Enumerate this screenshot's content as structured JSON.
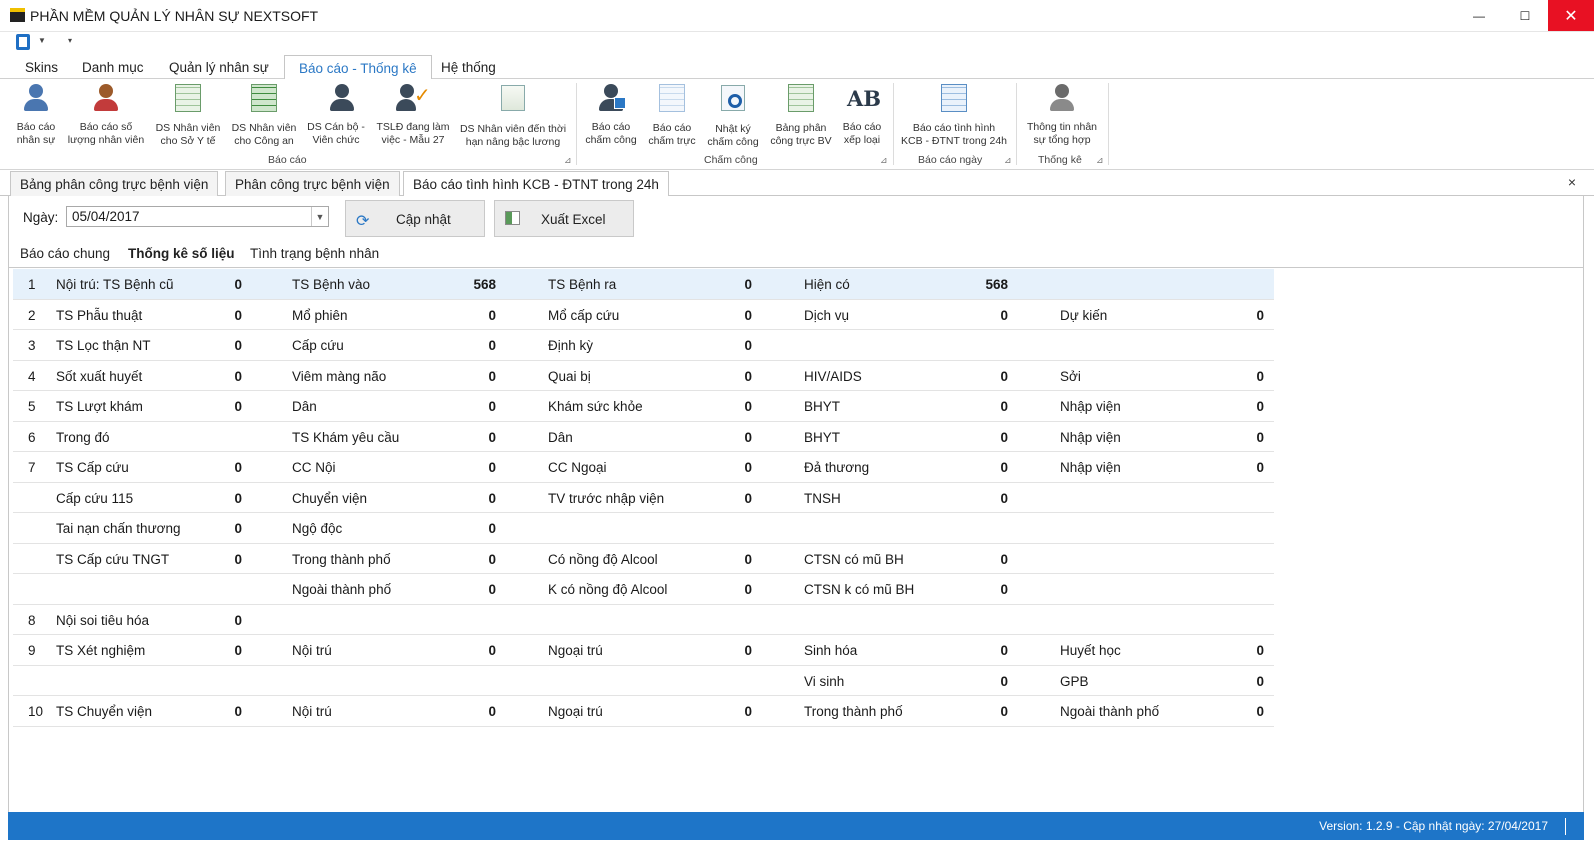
{
  "window": {
    "title": "PHẦN MỀM QUẢN LÝ NHÂN SỰ NEXTSOFT",
    "min": "—",
    "max": "☐",
    "close": "✕"
  },
  "menu": {
    "tabs": [
      "Skins",
      "Danh mục",
      "Quản lý nhân sự",
      "Báo cáo - Thống kê",
      "Hệ thống"
    ]
  },
  "ribbon": {
    "buttons": [
      "Báo cáo\nnhân sự",
      "Báo cáo số\nlượng nhân viên",
      "DS Nhân viên\ncho Sở Y tế",
      "DS Nhân viên\ncho Công an",
      "DS Cán bộ -\nViên chức",
      "TSLĐ đang làm\nviệc - Mẫu 27",
      "DS Nhân viên đến thời\nhạn nâng bậc lương",
      "Báo cáo\nchấm công",
      "Báo cáo\nchấm trực",
      "Nhật ký\nchấm công",
      "Bảng phân\ncông trực BV",
      "Báo cáo\nxếp loại",
      "Báo cáo tình hình\nKCB - ĐTNT trong 24h",
      "Thông tin nhân\nsự tổng hợp"
    ],
    "ab_text": "AB",
    "groups": [
      "Báo cáo",
      "Chấm công",
      "Báo cáo ngày",
      "Thống kê"
    ],
    "dialog_glyph": "⊿"
  },
  "doc_tabs": [
    "Bảng phân công trực bệnh viện",
    "Phân công trực bệnh viện",
    "Báo cáo tình hình KCB - ĐTNT trong 24h"
  ],
  "doc_close": "×",
  "filter": {
    "date_label": "Ngày:",
    "date_value": "05/04/2017",
    "dropdown_glyph": "▼",
    "update_label": "Cập nhật",
    "update_glyph": "⟳",
    "export_label": "Xuất Excel"
  },
  "sub_tabs": [
    "Báo cáo chung",
    "Thống kê số liệu",
    "Tình trạng bệnh nhân"
  ],
  "rows": [
    {
      "n": "1",
      "c": [
        [
          "Nội trú: TS Bệnh cũ",
          "0"
        ],
        [
          "TS Bệnh vào",
          "568"
        ],
        [
          "TS Bệnh ra",
          "0"
        ],
        [
          "Hiện có",
          "568"
        ],
        [
          "",
          ""
        ]
      ]
    },
    {
      "n": "2",
      "c": [
        [
          "TS Phẫu thuật",
          "0"
        ],
        [
          "Mổ phiên",
          "0"
        ],
        [
          "Mổ cấp cứu",
          "0"
        ],
        [
          "Dịch vụ",
          "0"
        ],
        [
          "Dự kiến",
          "0"
        ]
      ]
    },
    {
      "n": "3",
      "c": [
        [
          "TS Lọc thận NT",
          "0"
        ],
        [
          "Cấp cứu",
          "0"
        ],
        [
          "Định kỳ",
          "0"
        ],
        [
          "",
          ""
        ],
        [
          "",
          ""
        ]
      ]
    },
    {
      "n": "4",
      "c": [
        [
          "Sốt xuất huyết",
          "0"
        ],
        [
          "Viêm màng não",
          "0"
        ],
        [
          "Quai bị",
          "0"
        ],
        [
          "HIV/AIDS",
          "0"
        ],
        [
          "Sởi",
          "0"
        ]
      ]
    },
    {
      "n": "5",
      "c": [
        [
          "TS Lượt khám",
          "0"
        ],
        [
          "Dân",
          "0"
        ],
        [
          "Khám sức khỏe",
          "0"
        ],
        [
          "BHYT",
          "0"
        ],
        [
          "Nhập viện",
          "0"
        ]
      ]
    },
    {
      "n": "6",
      "c": [
        [
          "Trong đó",
          ""
        ],
        [
          "TS Khám yêu cầu",
          "0"
        ],
        [
          "Dân",
          "0"
        ],
        [
          "BHYT",
          "0"
        ],
        [
          "Nhập viện",
          "0"
        ]
      ]
    },
    {
      "n": "7",
      "c": [
        [
          "TS Cấp cứu",
          "0"
        ],
        [
          "CC Nội",
          "0"
        ],
        [
          "CC Ngoại",
          "0"
        ],
        [
          "Đả thương",
          "0"
        ],
        [
          "Nhập viện",
          "0"
        ]
      ]
    },
    {
      "n": "",
      "c": [
        [
          "Cấp cứu 115",
          "0"
        ],
        [
          "Chuyển viện",
          "0"
        ],
        [
          "TV trước nhập viện",
          "0"
        ],
        [
          "TNSH",
          "0"
        ],
        [
          "",
          ""
        ]
      ]
    },
    {
      "n": "",
      "c": [
        [
          "Tai nạn chấn thương",
          "0"
        ],
        [
          "Ngộ độc",
          "0"
        ],
        [
          "",
          ""
        ],
        [
          "",
          ""
        ],
        [
          "",
          ""
        ]
      ]
    },
    {
      "n": "",
      "c": [
        [
          "TS Cấp cứu TNGT",
          "0"
        ],
        [
          "Trong thành phố",
          "0"
        ],
        [
          "Có nồng độ Alcool",
          "0"
        ],
        [
          "CTSN có mũ BH",
          "0"
        ],
        [
          "",
          ""
        ]
      ]
    },
    {
      "n": "",
      "c": [
        [
          "",
          ""
        ],
        [
          "Ngoài thành phố",
          "0"
        ],
        [
          "K có nồng độ Alcool",
          "0"
        ],
        [
          "CTSN k có mũ BH",
          "0"
        ],
        [
          "",
          ""
        ]
      ]
    },
    {
      "n": "8",
      "c": [
        [
          "Nội soi tiêu hóa",
          "0"
        ],
        [
          "",
          ""
        ],
        [
          "",
          ""
        ],
        [
          "",
          ""
        ],
        [
          "",
          ""
        ]
      ]
    },
    {
      "n": "9",
      "c": [
        [
          "TS Xét nghiệm",
          "0"
        ],
        [
          "Nội trú",
          "0"
        ],
        [
          "Ngoại trú",
          "0"
        ],
        [
          "Sinh hóa",
          "0"
        ],
        [
          "Huyết học",
          "0"
        ]
      ]
    },
    {
      "n": "",
      "c": [
        [
          "",
          ""
        ],
        [
          "",
          ""
        ],
        [
          "",
          ""
        ],
        [
          "Vi sinh",
          "0"
        ],
        [
          "GPB",
          "0"
        ]
      ]
    },
    {
      "n": "10",
      "c": [
        [
          "TS Chuyển viện",
          "0"
        ],
        [
          "Nội trú",
          "0"
        ],
        [
          "Ngoại trú",
          "0"
        ],
        [
          "Trong thành phố",
          "0"
        ],
        [
          "Ngoài thành phố",
          "0"
        ]
      ]
    }
  ],
  "status": {
    "text": "Version: 1.2.9 - Cập nhật ngày: 27/04/2017"
  },
  "colors": {
    "accent": "#2b78c5",
    "status_bar": "#1e75c8",
    "close_button": "#e81123",
    "row_highlight": "#e6f1fb"
  }
}
